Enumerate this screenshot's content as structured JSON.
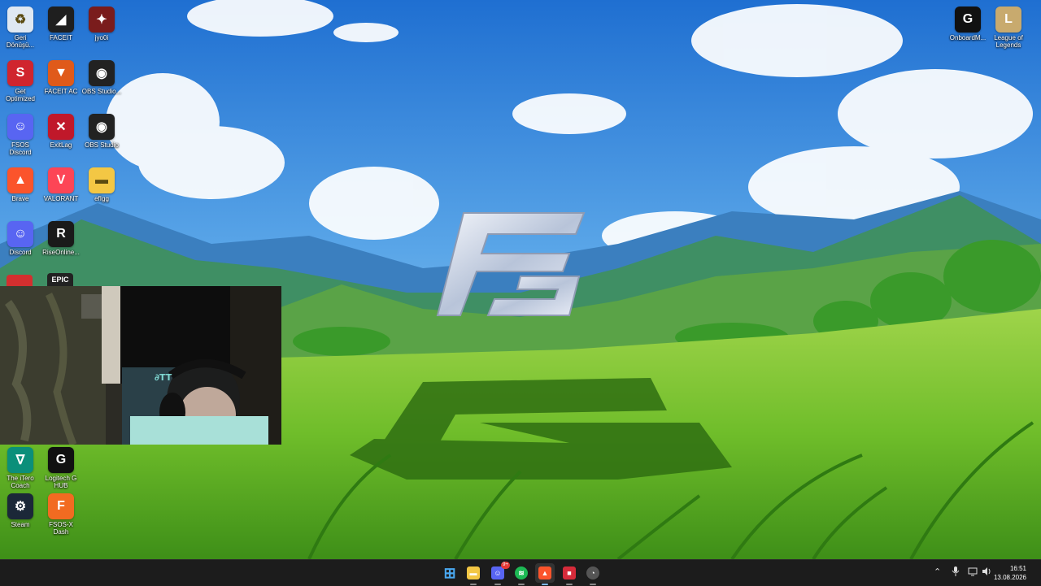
{
  "desktop": {
    "icons": [
      {
        "label": "Geri\nDönüşü...",
        "icon": "recycle-bin-icon",
        "color": "#dfe8f2"
      },
      {
        "label": "FACEIT",
        "icon": "faceit-icon",
        "color": "#1f1f1f"
      },
      {
        "label": "jyo0i",
        "icon": "game-icon",
        "color": "#7a1c1c"
      },
      {
        "label": "Get\nOptimized",
        "icon": "get-optimized-icon",
        "color": "#d0252e"
      },
      {
        "label": "FACEIT AC",
        "icon": "faceit-ac-icon",
        "color": "#e05a1a"
      },
      {
        "label": "OBS Studio...",
        "icon": "obs-icon",
        "color": "#222222"
      },
      {
        "label": "FSOS Discord",
        "icon": "discord-icon",
        "color": "#5865f2"
      },
      {
        "label": "ExitLag",
        "icon": "exitlag-icon",
        "color": "#c0182a"
      },
      {
        "label": "OBS Studio",
        "icon": "obs-icon",
        "color": "#222222"
      },
      {
        "label": "Brave",
        "icon": "brave-icon",
        "color": "#fb542b"
      },
      {
        "label": "VALORANT",
        "icon": "valorant-icon",
        "color": "#fd4556"
      },
      {
        "label": "efIgg",
        "icon": "folder-icon",
        "color": "#f3c744"
      },
      {
        "label": "Discord",
        "icon": "discord-icon",
        "color": "#5865f2"
      },
      {
        "label": "RiseOnline...",
        "icon": "rise-online-icon",
        "color": "#1a1a1a"
      },
      {
        "label": "The iTero\nCoach",
        "icon": "itero-icon",
        "color": "#0b8f7a"
      },
      {
        "label": "Logitech G\nHUB",
        "icon": "logitech-icon",
        "color": "#111111"
      },
      {
        "label": "Steam",
        "icon": "steam-icon",
        "color": "#1b2838"
      },
      {
        "label": "FSOS-X Dash",
        "icon": "fsos-icon",
        "color": "#f26b21"
      },
      {
        "label": "OnboardM...",
        "icon": "logitech-icon",
        "color": "#111111"
      },
      {
        "label": "League of\nLegends",
        "icon": "league-icon",
        "color": "#c8aa6e"
      }
    ],
    "partial_icons": [
      {
        "label": "",
        "icon": "red-app-icon",
        "color": "#d32f2f"
      },
      {
        "label": "EPIC",
        "icon": "epic-games-icon",
        "color": "#222222"
      }
    ],
    "wallpaper_logo": "FS"
  },
  "taskbar": {
    "apps": [
      {
        "name": "start",
        "icon": "windows-start-icon",
        "color": "#4aa8f0"
      },
      {
        "name": "file-explorer",
        "icon": "folder-icon",
        "color": "#f3c744"
      },
      {
        "name": "discord",
        "icon": "discord-icon",
        "color": "#5865f2",
        "badge": "9+"
      },
      {
        "name": "spotify",
        "icon": "spotify-icon",
        "color": "#1db954"
      },
      {
        "name": "brave",
        "icon": "brave-icon",
        "color": "#fb542b"
      },
      {
        "name": "app-red",
        "icon": "red-app-icon",
        "color": "#d62b3a"
      },
      {
        "name": "steelseries",
        "icon": "gauge-icon",
        "color": "#555555"
      }
    ],
    "tray": {
      "time": "16:51",
      "date": "13.08.2026"
    }
  }
}
